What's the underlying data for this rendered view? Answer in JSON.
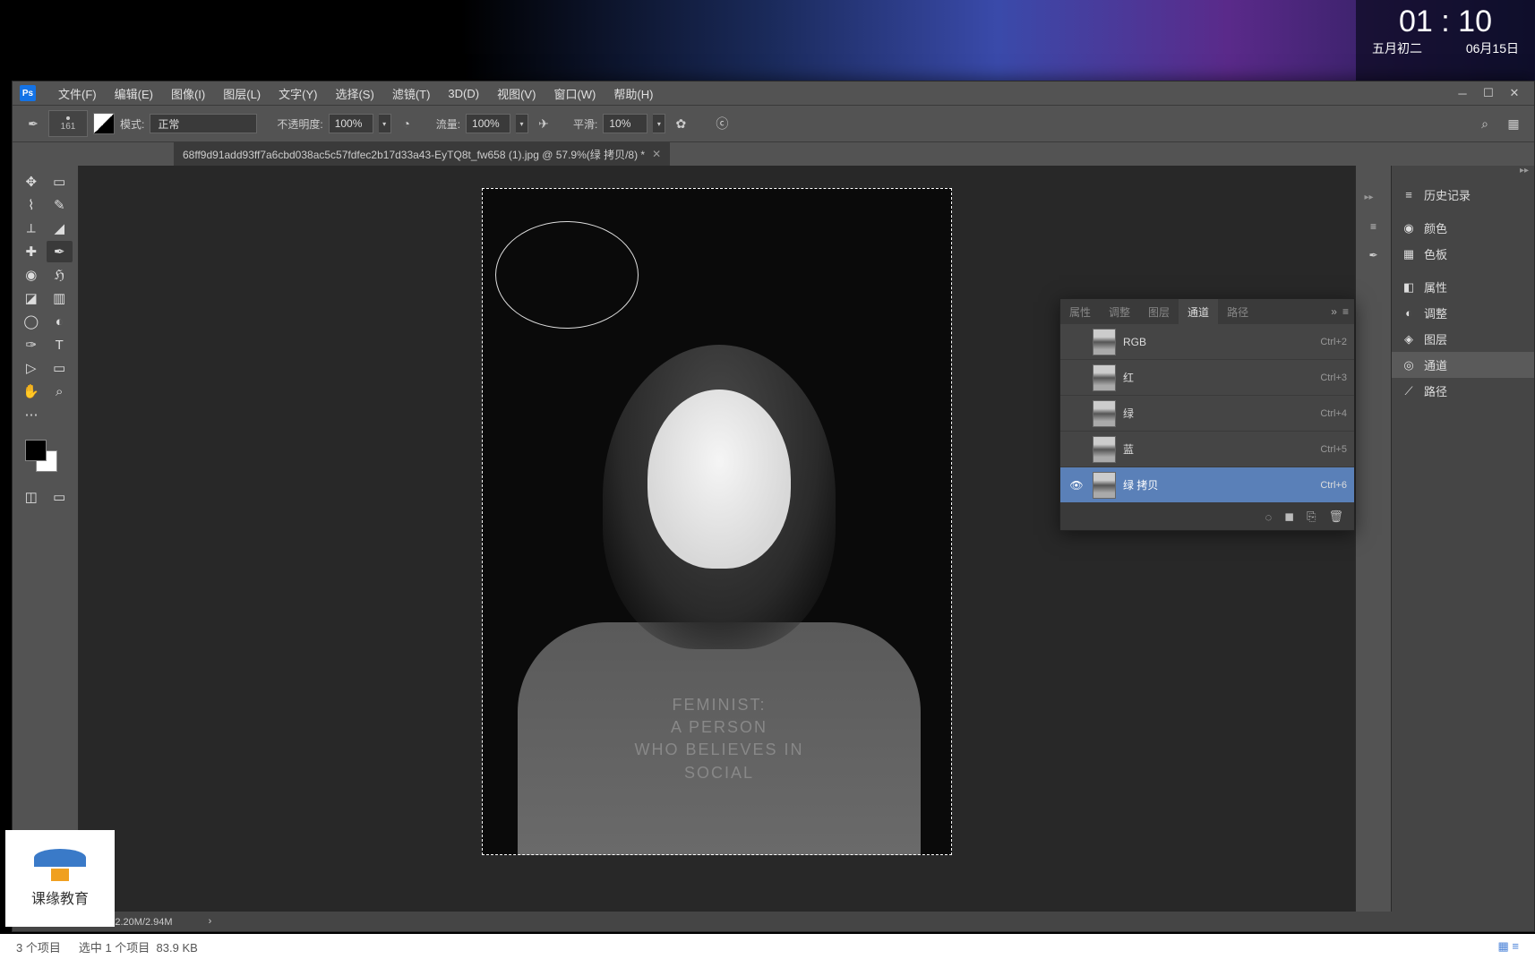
{
  "clock": {
    "time": "01 : 10",
    "lunar": "五月初二",
    "date": "06月15日"
  },
  "menu": {
    "file": "文件(F)",
    "edit": "编辑(E)",
    "image": "图像(I)",
    "layer": "图层(L)",
    "type": "文字(Y)",
    "select": "选择(S)",
    "filter": "滤镜(T)",
    "three_d": "3D(D)",
    "view": "视图(V)",
    "window": "窗口(W)",
    "help": "帮助(H)"
  },
  "options": {
    "brush_size": "161",
    "mode_label": "模式:",
    "mode_value": "正常",
    "opacity_label": "不透明度:",
    "opacity_value": "100%",
    "flow_label": "流量:",
    "flow_value": "100%",
    "smooth_label": "平滑:",
    "smooth_value": "10%"
  },
  "tab": {
    "title": "68ff9d91add93ff7a6cbd038ac5c57fdfec2b17d33a43-EyTQ8t_fw658 (1).jpg @ 57.9%(绿 拷贝/8) *"
  },
  "canvas_body_text": {
    "line1": "FEMINIST:",
    "line2": "A PERSON",
    "line3": "WHO BELIEVES IN",
    "line4": "SOCIAL"
  },
  "right_panels": {
    "history": "历史记录",
    "color": "颜色",
    "swatches": "色板",
    "properties": "属性",
    "adjustments": "调整",
    "layers": "图层",
    "channels": "通道",
    "paths": "路径"
  },
  "channel_tabs": {
    "properties": "属性",
    "adjustments": "调整",
    "layers": "图层",
    "channels": "通道",
    "paths": "路径"
  },
  "channels": [
    {
      "name": "RGB",
      "shortcut": "Ctrl+2",
      "visible": false
    },
    {
      "name": "红",
      "shortcut": "Ctrl+3",
      "visible": false
    },
    {
      "name": "绿",
      "shortcut": "Ctrl+4",
      "visible": false
    },
    {
      "name": "蓝",
      "shortcut": "Ctrl+5",
      "visible": false
    },
    {
      "name": "绿 拷贝",
      "shortcut": "Ctrl+6",
      "visible": true
    }
  ],
  "status": {
    "zoom": "57.85%",
    "doc": "文档:2.20M/2.94M"
  },
  "explorer": {
    "items": "3 个项目",
    "selected": "选中 1 个项目",
    "size": "83.9 KB"
  },
  "watermark": "课缘教育"
}
